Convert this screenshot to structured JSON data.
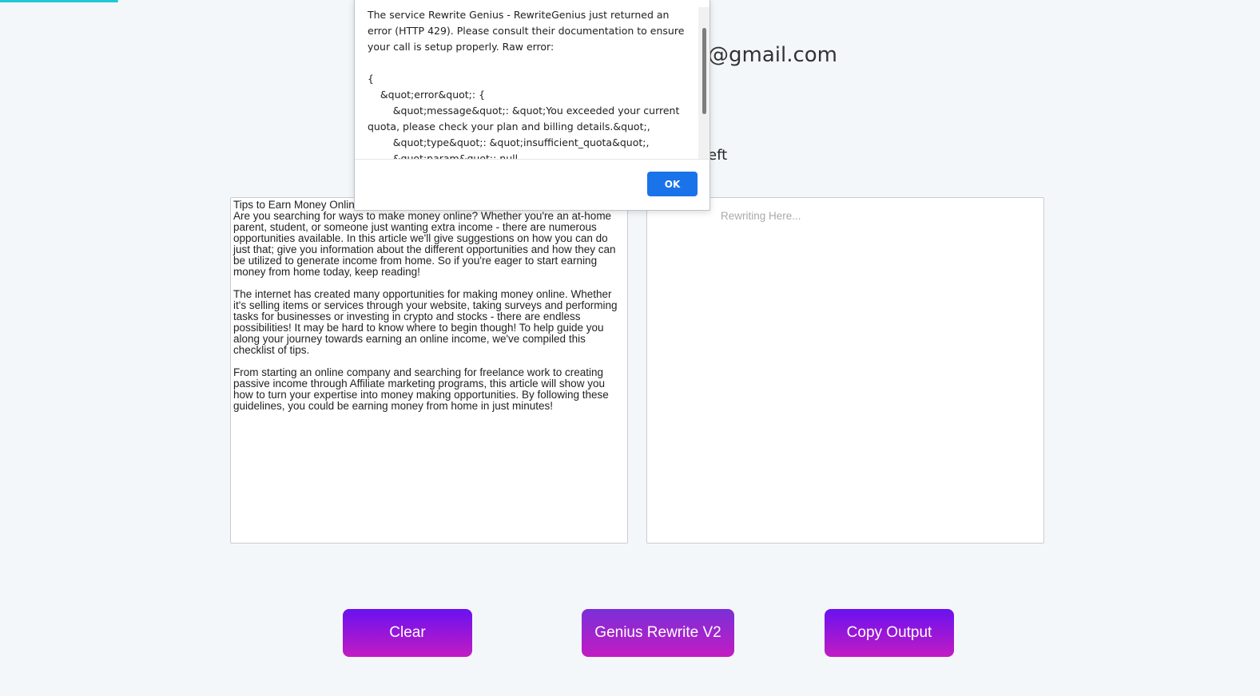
{
  "header": {
    "email_suffix": "@gmail.com",
    "credits_suffix": "eft"
  },
  "input_panel": {
    "text": "Tips to Earn Money Online\nAre you searching for ways to make money online? Whether you're an at-home parent, student, or someone just wanting extra income - there are numerous opportunities available. In this article we'll give suggestions on how you can do just that; give you information about the different opportunities and how they can be utilized to generate income from home. So if you're eager to start earning money from home today, keep reading!\n\nThe internet has created many opportunities for making money online. Whether it's selling items or services through your website, taking surveys and performing tasks for businesses or investing in crypto and stocks - there are endless possibilities! It may be hard to know where to begin though! To help guide you along your journey towards earning an online income, we've compiled this checklist of tips.\n\nFrom starting an online company and searching for freelance work to creating passive income through Affiliate marketing programs, this article will show you how to turn your expertise into money making opportunities. By following these guidelines, you could be earning money from home in just minutes!"
  },
  "output_panel": {
    "placeholder_visible": "Rewriting Here..."
  },
  "buttons": {
    "clear": "Clear",
    "rewrite": "Genius Rewrite V2",
    "copy": "Copy Output"
  },
  "dialog": {
    "message": "The service Rewrite Genius - RewriteGenius just returned an error (HTTP 429). Please consult their documentation to ensure your call is setup properly. Raw error:\n\n{\n    &quot;error&quot;: {\n        &quot;message&quot;: &quot;You exceeded your current quota, please check your plan and billing details.&quot;,\n        &quot;type&quot;: &quot;insufficient_quota&quot;,\n        &quot;param&quot;: null",
    "ok_label": "OK"
  },
  "colors": {
    "button_gradient_top": "#6a11f0",
    "button_gradient_bottom": "#c21cc2",
    "ok_button": "#1a73e8",
    "accent": "#1ec8d6"
  }
}
